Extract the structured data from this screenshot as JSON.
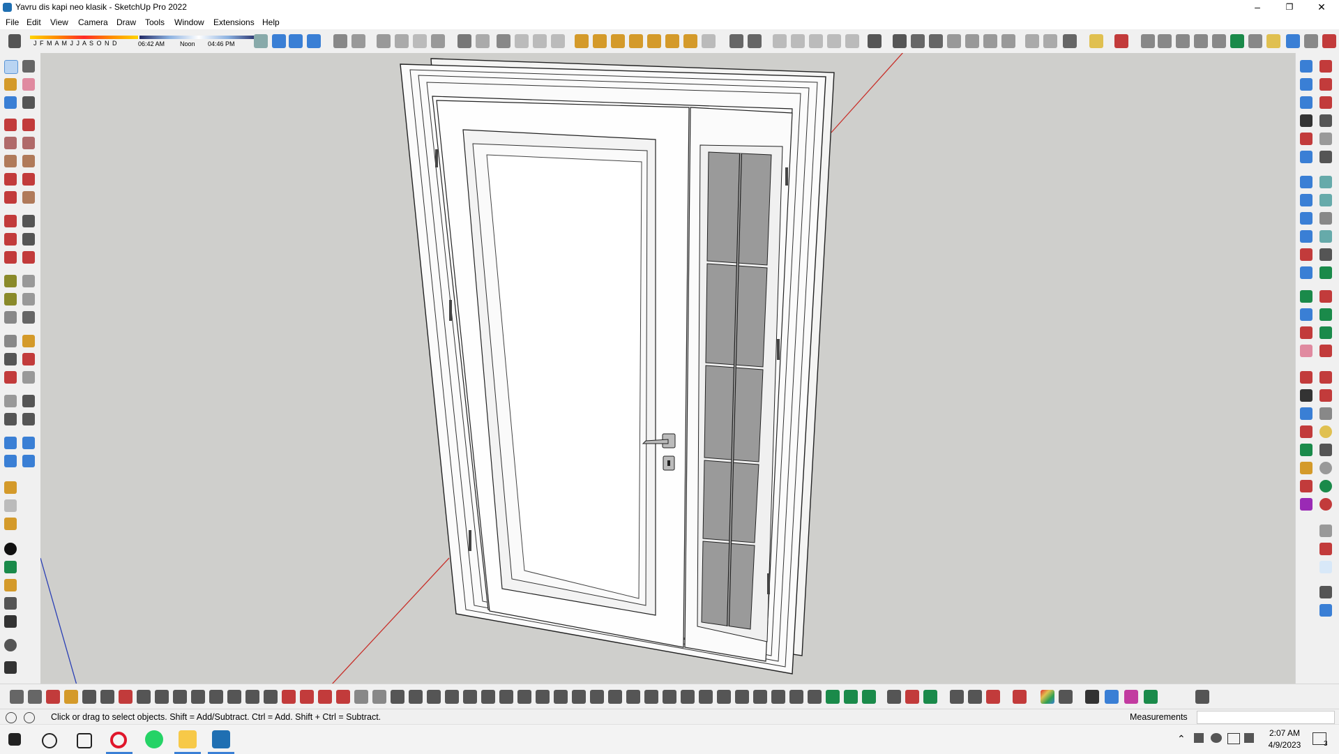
{
  "window": {
    "title": "Yavru dis kapi neo klasik - SketchUp Pro 2022",
    "minimize": "–",
    "maximize": "❐",
    "close": "✕"
  },
  "menu": [
    "File",
    "Edit",
    "View",
    "Camera",
    "Draw",
    "Tools",
    "Window",
    "Extensions",
    "Help"
  ],
  "shadow": {
    "months": "J F M A M J J A S O N D",
    "time_start": "06:42 AM",
    "time_mid": "Noon",
    "time_end": "04:46 PM"
  },
  "status": {
    "hint": "Click or drag to select objects. Shift = Add/Subtract. Ctrl = Add. Shift + Ctrl = Subtract.",
    "measurements_label": "Measurements",
    "measurements_value": ""
  },
  "taskbar": {
    "time": "2:07 AM",
    "date": "4/9/2023",
    "notification_count": "3"
  },
  "colors": {
    "viewport_bg": "#cfcfcc",
    "red_axis": "#c8302a",
    "blue_axis": "#2a3fb5",
    "opera": "#e0162b",
    "whatsapp": "#25d366",
    "explorer": "#f7c948",
    "sketchup": "#1f6fb2"
  },
  "icons": {
    "start": "windows-start-icon",
    "search": "search-icon",
    "taskview": "task-view-icon"
  }
}
